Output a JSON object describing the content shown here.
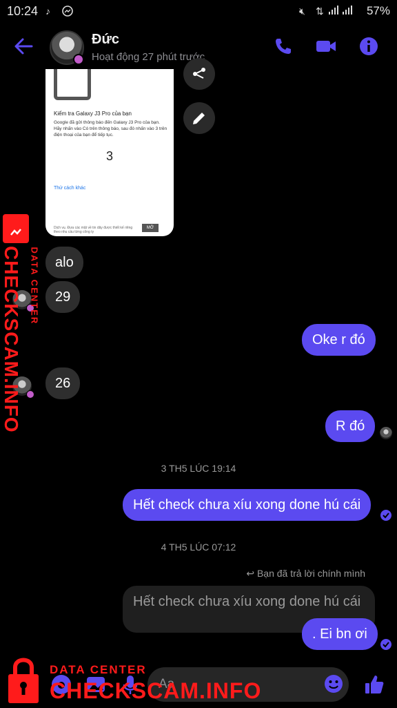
{
  "status_bar": {
    "time": "10:24",
    "battery": "57%",
    "left_icons": [
      "tiktok-icon",
      "messenger-icon"
    ],
    "right_icons": [
      "mute-icon",
      "data-icon",
      "signal-icon",
      "signal-icon"
    ]
  },
  "header": {
    "name": "Đức",
    "status": "Hoạt động 27 phút trước",
    "accent": "#5b4af0"
  },
  "shared_image": {
    "title": "Kiểm tra Galaxy J3 Pro của bạn",
    "body": "Google đã gửi thông báo đến Galaxy J3 Pro của bạn. Hãy nhấn vào Có trên thông báo, sau đó nhấn vào 3 trên điện thoại của bạn để tiếp tục.",
    "number": "3",
    "link": "Thử cách khác",
    "ad_text": "Dịch vụ. Đưa các mặt về tin dây được thiết kế riêng theo nhu cầu từng công ty",
    "ad_button": "MỞ"
  },
  "messages": [
    {
      "side": "in",
      "text": "alo"
    },
    {
      "side": "in",
      "text": "29"
    },
    {
      "side": "out",
      "text": "Oke r đó"
    },
    {
      "side": "in",
      "text": "26"
    },
    {
      "side": "out",
      "text": "R đó"
    },
    {
      "type": "timestamp",
      "text": "3 TH5 LÚC 19:14"
    },
    {
      "side": "out",
      "text": "Hết check chưa xíu xong done hú cái"
    },
    {
      "type": "timestamp",
      "text": "4 TH5 LÚC 07:12"
    },
    {
      "type": "reply_label",
      "text": "Bạn đã trả lời chính mình"
    },
    {
      "type": "quoted",
      "text": "Hết check chưa xíu xong done hú cái"
    },
    {
      "side": "out",
      "text": ". Ei bn ơi"
    }
  ],
  "composer": {
    "placeholder": "Aa"
  },
  "watermark": {
    "sub": "DATA CENTER",
    "main": "CHECKSCAM.INFO",
    "color": "#ff1b1b"
  }
}
